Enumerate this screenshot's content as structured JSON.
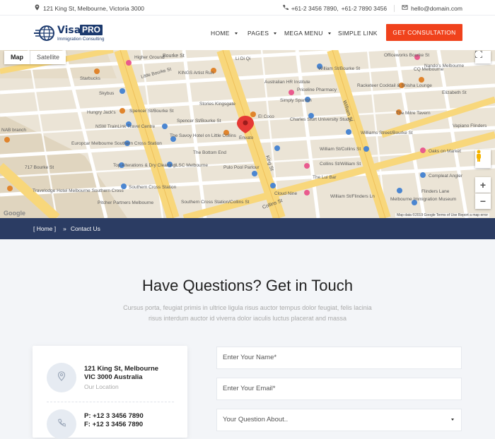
{
  "topbar": {
    "address": "121 King St, Melbourne, Victoria 3000",
    "phone_1": "+61-2 3456 7890,",
    "phone_2": "+61-2 7890 3456",
    "email": "hello@domain.com"
  },
  "brand": {
    "name": "Visa",
    "badge": "PRO",
    "tagline": "Immigration Consulting",
    "color": "#1c3a6e"
  },
  "nav": {
    "items": [
      {
        "label": "HOME",
        "dropdown": true
      },
      {
        "label": "PAGES",
        "dropdown": true
      },
      {
        "label": "MEGA MENU",
        "dropdown": true
      },
      {
        "label": "SIMPLE LINK",
        "dropdown": false
      }
    ],
    "cta_label": "GET CONSULTATION",
    "cta_color": "#f0421c"
  },
  "map": {
    "tab_map": "Map",
    "tab_satellite": "Satellite",
    "zoom_in": "+",
    "zoom_out": "−",
    "attribution": "Map data ©2019 Google   Terms of Use   Report a map error",
    "google_logo": "Google",
    "marker_label": "Envato",
    "labels": [
      "Higher Ground",
      "Little Bourke St",
      "KINGS Artist Run",
      "Li Di Qi",
      "William St/Bourke St",
      "Officeworks Bourke St",
      "Nando's Melbourne",
      "CQ Melbourne",
      "Starbucks",
      "Australian HR Institute",
      "Priceline Pharmacy",
      "Racketeer Cocktail & Shisha Lounge",
      "Skybus",
      "Elizabeth St",
      "Simply Spanish",
      "Hungry Jack's",
      "Spencer St/Bourke St",
      "Spencer St/Bourke St",
      "Stories Kingsgate",
      "El Coco",
      "Charles Sturt University Study...",
      "The Mitre Tavern",
      "NSW TrainLink Travel Centre",
      "The Savoy Hotel on Little Collins",
      "NAB branch",
      "Williams Street/Bourke St",
      "Vapiano Flinders",
      "Europcar Melbourne Southern Cross Station",
      "The Bottom End",
      "Envato",
      "William St/Collins St",
      "Oaks on Market",
      "717 Bourke St",
      "Top Alterations & Dry Cleaning",
      "ILSC Melbourne",
      "Pulo Pool Parlour",
      "Collins St/William St",
      "Compleat Angler",
      "Southern Cross Station",
      "Cloud Nine",
      "The Lui Bar",
      "Travelodge Hotel Melbourne Southern Cross",
      "Pitcher Partners Melbourne",
      "Southern Cross Station/Collins St",
      "William St/Flinders Ln",
      "Flinders Lane",
      "Melbourne Immigration Museum",
      "King St",
      "William St",
      "Collins St",
      "Bourke St"
    ]
  },
  "breadcrumb": {
    "home": "[ Home ]",
    "separator": "»",
    "current": "Contact Us"
  },
  "contact": {
    "heading": "Have Questions? Get in Touch",
    "intro": "Cursus porta, feugiat primis in ultrice ligula risus auctor tempus dolor feugiat, felis lacinia risus interdum auctor id viverra dolor iaculis luctus placerat and massa",
    "address_line1": "121 King St, Melbourne",
    "address_line2": "VIC 3000 Australia",
    "address_caption": "Our Location",
    "phone_line": "P: +12 3 3456 7890",
    "phone_line2": "F: +12 3 3456 7890",
    "form": {
      "name_placeholder": "Enter Your Name*",
      "email_placeholder": "Enter Your Email*",
      "question_placeholder": "Your Question About.."
    }
  },
  "colors": {
    "breadcrumb_bg": "#2b3c63",
    "accent": "#f0421c"
  }
}
